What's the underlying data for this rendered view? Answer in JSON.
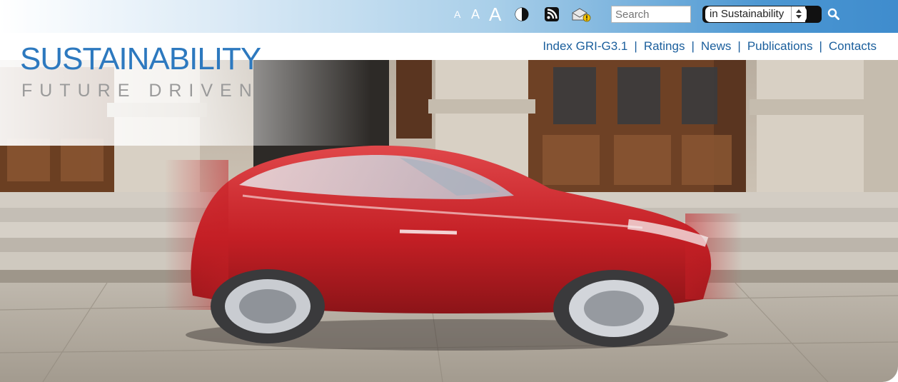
{
  "header": {
    "font_size_small": "A",
    "font_size_medium": "A",
    "font_size_large": "A",
    "search_placeholder": "Search",
    "search_scope": "in Sustainability"
  },
  "icons": [
    "contrast-icon",
    "rss-icon",
    "newsletter-icon",
    "search-icon"
  ],
  "nav": {
    "items": [
      {
        "label": "Index GRI-G3.1"
      },
      {
        "label": "Ratings"
      },
      {
        "label": "News"
      },
      {
        "label": "Publications"
      },
      {
        "label": "Contacts"
      }
    ],
    "separator": "|"
  },
  "logo": {
    "title": "SUSTAINABILITY",
    "subtitle": "FUTURE DRIVEN"
  },
  "colors": {
    "accent": "#1a5e9c",
    "logo_blue": "#2d79bf",
    "topbar_blue": "#3f8ccd",
    "car_red": "#c8242a"
  }
}
